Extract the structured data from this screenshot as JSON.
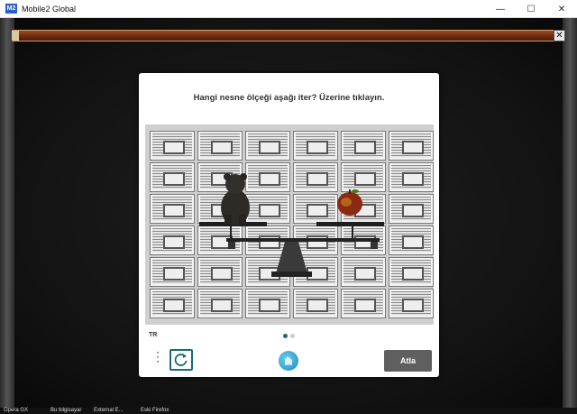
{
  "window": {
    "title": "Mobile2 Global",
    "icon_name": "app-icon",
    "icon_text": "M2"
  },
  "window_controls": {
    "minimize": "—",
    "maximize": "☐",
    "close": "✕"
  },
  "game": {
    "close_glyph": "✕"
  },
  "captcha": {
    "prompt": "Hangi nesne ölçeği aşağı iter? Üzerine tıklayın.",
    "language": "TR",
    "skip_label": "Atla",
    "page_count": 2,
    "active_page": 1,
    "accent_color": "#1c6b74",
    "objects": [
      "bear-figure",
      "apple"
    ],
    "menu_glyph": "⋮"
  },
  "taskbar": {
    "items": [
      "Opera GX",
      "Bu bilgisayar",
      "External E...",
      "Eski Firefox"
    ]
  }
}
